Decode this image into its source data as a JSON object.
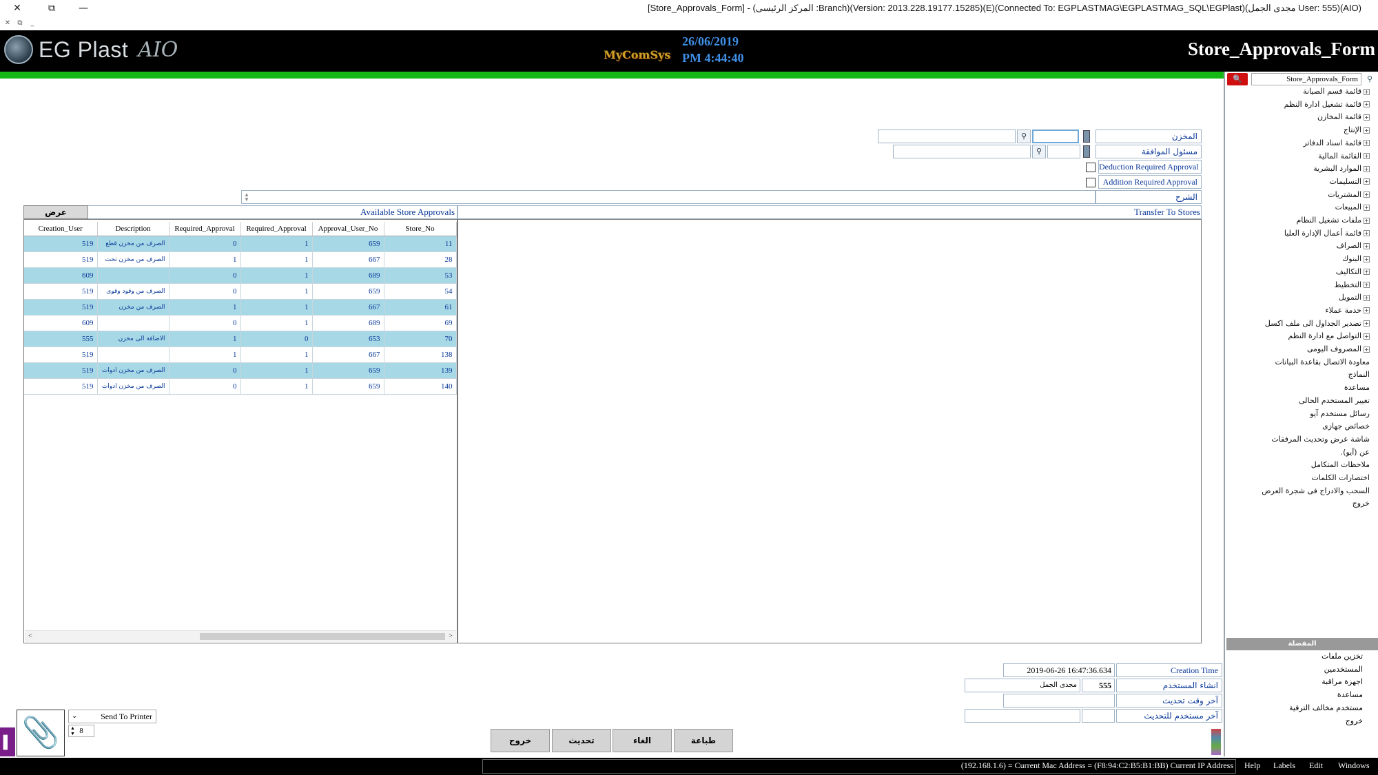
{
  "window": {
    "title": "[Store_Approvals_Form] - (المركز الرئيسى :Branch)(Version: 2013.228.19177.15285)(E)(Connected To: EGPLASTMAG\\EGPLASTMAG_SQL\\EGPlast)(مجدى الجمل User: 555)(AIO)",
    "close": "✕",
    "restore": "⧉",
    "minimize": "—"
  },
  "header": {
    "logo_text": "EG Plast",
    "logo_aio": "AIO",
    "mycomsys": "MyComSys",
    "date": "26/06/2019",
    "time": "PM 4:44:40",
    "form_title": "Store_Approvals_Form"
  },
  "tree": {
    "search_value": "Store_Approvals_Form",
    "items": [
      {
        "label": "قائمة قسم الصيانة",
        "expand": true
      },
      {
        "label": "قائمة تشغيل ادارة النظم",
        "expand": true
      },
      {
        "label": "قائمة المخازن",
        "expand": true
      },
      {
        "label": "الإنتاج",
        "expand": true
      },
      {
        "label": "قائمة اسناد الدفاتر",
        "expand": true
      },
      {
        "label": "القائمة المالية",
        "expand": true
      },
      {
        "label": "الموارد البشرية",
        "expand": true
      },
      {
        "label": "التسليمات",
        "expand": true
      },
      {
        "label": "المشتريات",
        "expand": true
      },
      {
        "label": "المبيعات",
        "expand": true
      },
      {
        "label": "ملفات تشغيل النظام",
        "expand": true
      },
      {
        "label": "قائمة أعمال الإدارة العليا",
        "expand": true
      },
      {
        "label": "الصراف",
        "expand": true
      },
      {
        "label": "البنوك",
        "expand": true
      },
      {
        "label": "التكاليف",
        "expand": true
      },
      {
        "label": "التخطيط",
        "expand": true
      },
      {
        "label": "التمويل",
        "expand": true
      },
      {
        "label": "خدمة عملاء",
        "expand": true
      },
      {
        "label": "تصدير الجداول الى ملف اكسل",
        "expand": true
      },
      {
        "label": "التواصل مع ادارة النظم",
        "expand": true
      },
      {
        "label": "المصروف اليومى",
        "expand": true
      },
      {
        "label": "معاودة الاتصال بقاعدة البيانات",
        "expand": false
      },
      {
        "label": "النماذج",
        "expand": false
      },
      {
        "label": "مساعدة",
        "expand": false
      },
      {
        "label": "تغيير المستخدم الحالى",
        "expand": false
      },
      {
        "label": "رسائل مستخدم آيو",
        "expand": false
      },
      {
        "label": "خصائص جهازى",
        "expand": false
      },
      {
        "label": "شاشة عرض وتحديث المرفقات",
        "expand": false
      },
      {
        "label": "عن (آيو).",
        "expand": false
      },
      {
        "label": "ملاحظات المتكامل",
        "expand": false
      },
      {
        "label": "اختصارات الكلمات",
        "expand": false
      },
      {
        "label": "السحب والادراج فى شجرة العرض",
        "expand": false
      },
      {
        "label": "خروج",
        "expand": false
      }
    ],
    "shortcuts_title": "المفضلة",
    "shortcuts": [
      "تخزين ملفات",
      "المستخدمين",
      "اجهزة مراقبة",
      "مساعدة",
      "مستخدم مخالف الترقية",
      "خروج"
    ]
  },
  "form": {
    "store_label": "المخزن",
    "approval_resp_label": "مسئول الموافقة",
    "deduction_label": "Deduction Required Approval",
    "addition_label": "Addition Required Approval",
    "notes_label": "الشرح",
    "show_button": "عرض",
    "available_title": "Available Store Approvals",
    "transfer_title": "Transfer To Stores"
  },
  "grid": {
    "columns": [
      "Creation_User",
      "Description",
      "Required_Approval",
      "Required_Approval",
      "Approval_User_No",
      "Store_No"
    ],
    "rows": [
      [
        "519",
        "الصرف من مخزن قطع",
        "0",
        "1",
        "659",
        "11"
      ],
      [
        "519",
        "الصرف من مخزن تحت",
        "1",
        "1",
        "667",
        "28"
      ],
      [
        "609",
        "",
        "0",
        "1",
        "689",
        "53"
      ],
      [
        "519",
        "الصرف من وقود وقوى",
        "0",
        "1",
        "659",
        "54"
      ],
      [
        "519",
        "الصرف من مخزن",
        "1",
        "1",
        "667",
        "61"
      ],
      [
        "609",
        "",
        "0",
        "1",
        "689",
        "69"
      ],
      [
        "555",
        "الاضافة الى مخزن",
        "1",
        "0",
        "653",
        "70"
      ],
      [
        "519",
        "",
        "1",
        "1",
        "667",
        "138"
      ],
      [
        "519",
        "الصرف من مخزن ادوات",
        "0",
        "1",
        "659",
        "139"
      ],
      [
        "519",
        "الصرف من مخزن ادوات",
        "0",
        "1",
        "659",
        "140"
      ]
    ]
  },
  "audit": {
    "creation_time_label": "Creation Time",
    "creation_time_value": "2019-06-26 16:47:36.634",
    "created_by_label": "انشاء المستخدم",
    "created_by_no": "555",
    "created_by_name": "مجدى الجمل",
    "last_update_label": "آخر وقت تحديث",
    "last_user_label": "آخر مستخدم للتحديث"
  },
  "buttons": {
    "print": "طباعة",
    "cancel": "الغاء",
    "update": "تحديث",
    "exit": "خروج"
  },
  "printer": {
    "target": "Send To Printer",
    "copies": "8"
  },
  "statusbar": {
    "text": "(192.168.1.6) = Current Mac Address = (F8:94:C2:B5:B1:BB) Current IP Address",
    "menu": [
      "Help",
      "Labels",
      "Edit",
      "Windows"
    ]
  }
}
